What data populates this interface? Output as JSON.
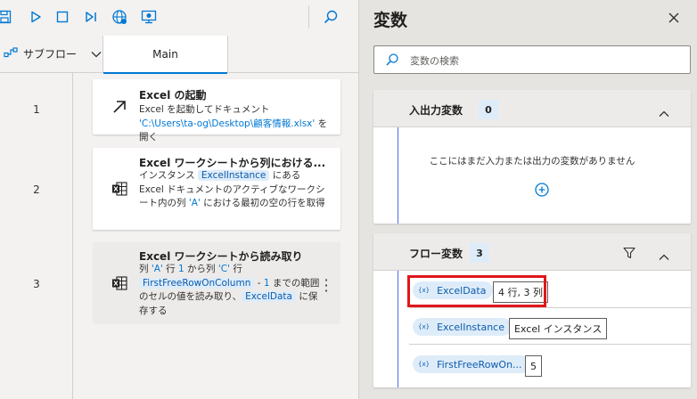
{
  "toolbar": {
    "buttons": [
      {
        "name": "save-icon"
      },
      {
        "name": "run-icon"
      },
      {
        "name": "stop-icon"
      },
      {
        "name": "run-next-action-icon"
      },
      {
        "name": "web-recorder-icon"
      },
      {
        "name": "desktop-recorder-icon"
      }
    ],
    "search_icon": "search-icon"
  },
  "tabs": {
    "subflow_label": "サブフロー",
    "main_label": "Main"
  },
  "actions": [
    {
      "line": "1",
      "icon": "launch-arrow-icon",
      "title": "Excel の起動",
      "desc_pre": "Excel を起動してドキュメント ",
      "desc_path": "'C:\\Users\\ta-og\\Desktop\\顧客情報.xlsx'",
      "desc_post": " を開く"
    },
    {
      "line": "2",
      "icon": "excel-sheet-icon",
      "title": "Excel ワークシートから列における...",
      "desc_pre": "インスタンス ",
      "desc_chip": "ExcelInstance",
      "desc_post": " にある Excel ドキュメントのアクティブなワークシート内の列 ",
      "desc_col": "'A'",
      "desc_tail": " における最初の空の行を取得"
    },
    {
      "line": "3",
      "icon": "excel-sheet-icon",
      "title": "Excel ワークシートから読み取り",
      "desc_a": "列 ",
      "desc_col1": "'A'",
      "desc_b": " 行 ",
      "desc_row1": "1",
      "desc_c": " から列 ",
      "desc_col2": "'C'",
      "desc_d": " 行",
      "desc_chip1": "FirstFreeRowOnColumn",
      "desc_e": " - ",
      "desc_num": "1",
      "desc_f": " までの範囲のセルの値を読み取り、",
      "desc_chip2": "ExcelData",
      "desc_g": " に保存する"
    }
  ],
  "variables_pane": {
    "title": "変数",
    "search_placeholder": "変数の検索",
    "io_section": {
      "title": "入出力変数",
      "count": "0",
      "empty_text": "ここにはまだ入力または出力の変数がありません"
    },
    "flow_section": {
      "title": "フロー変数",
      "count": "3",
      "items": [
        {
          "name": "ExcelData",
          "value": "4 行, 3 列",
          "highlighted": true
        },
        {
          "name": "ExcelInstance",
          "value": "Excel インスタンス"
        },
        {
          "name": "FirstFreeRowOn...",
          "value": "5"
        }
      ]
    }
  },
  "colors": {
    "accent": "#0078d4",
    "chip_bg": "#deecf9",
    "highlight": "#e0161b",
    "excel_green": "#107c41"
  }
}
